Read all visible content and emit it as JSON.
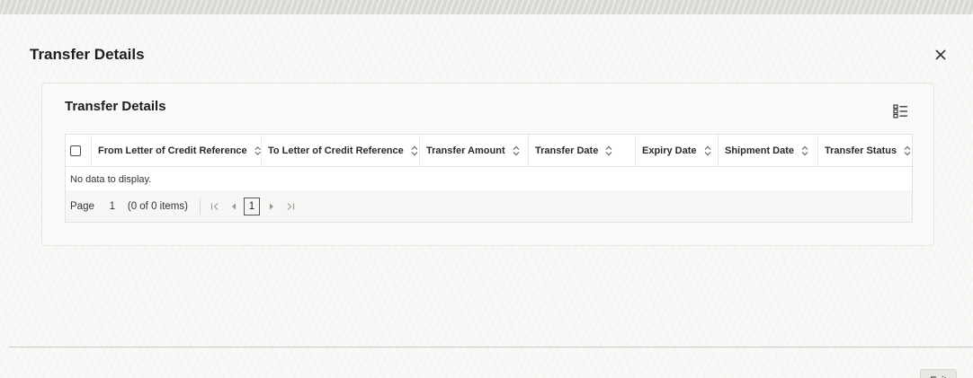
{
  "dialog": {
    "title": "Transfer Details",
    "close_icon": "close-icon"
  },
  "section": {
    "title": "Transfer Details",
    "view_icon": "list-view-icon"
  },
  "table": {
    "columns": [
      "From Letter of Credit Reference",
      "To Letter of Credit Reference",
      "Transfer Amount",
      "Transfer Date",
      "Expiry Date",
      "Shipment Date",
      "Transfer Status"
    ],
    "rows": [],
    "empty_message": "No data to display."
  },
  "pagination": {
    "label": "Page",
    "current_page_input": "1",
    "items_summary": "(0 of 0 items)",
    "pages": [
      "1"
    ],
    "icons": [
      "first-page-icon",
      "previous-page-icon",
      "next-page-icon",
      "last-page-icon"
    ]
  },
  "footer": {
    "exit_label": "Exit"
  },
  "colors": {
    "background": "#f5f4f1",
    "text": "#1d1d1d",
    "border": "#e4e2de"
  }
}
